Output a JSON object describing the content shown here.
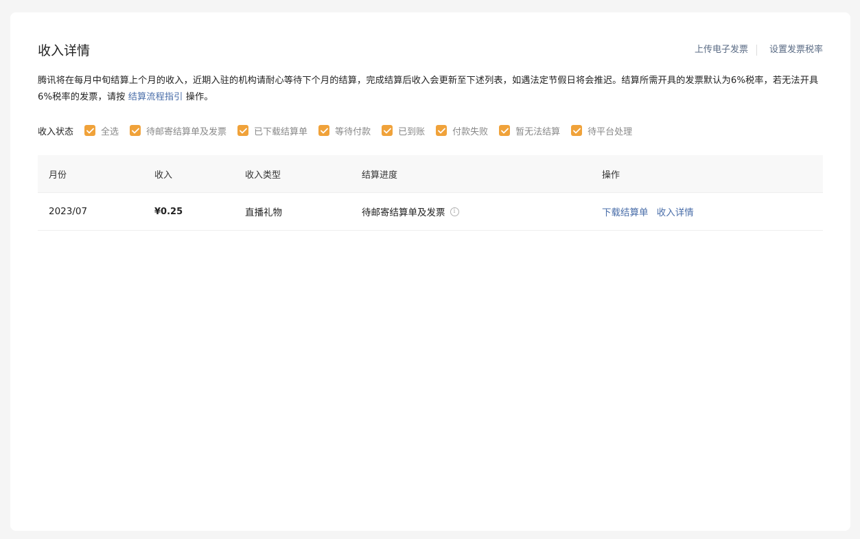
{
  "page": {
    "title": "收入详情",
    "header_actions": {
      "upload_invoice": "上传电子发票",
      "set_tax_rate": "设置发票税率"
    },
    "notice": {
      "text_before_link": "腾讯将在每月中旬结算上个月的收入，近期入驻的机构请耐心等待下个月的结算，完成结算后收入会更新至下述列表，如遇法定节假日将会推迟。结算所需开具的发票默认为6%税率，若无法开具6%税率的发票，请按 ",
      "link": "结算流程指引",
      "text_after_link": " 操作。"
    }
  },
  "status_filter": {
    "label": "收入状态",
    "options": [
      {
        "label": "全选",
        "checked": true
      },
      {
        "label": "待邮寄结算单及发票",
        "checked": true
      },
      {
        "label": "已下载结算单",
        "checked": true
      },
      {
        "label": "等待付款",
        "checked": true
      },
      {
        "label": "已到账",
        "checked": true
      },
      {
        "label": "付款失败",
        "checked": true
      },
      {
        "label": "暂无法结算",
        "checked": true
      },
      {
        "label": "待平台处理",
        "checked": true
      }
    ],
    "check_color": "#f0a23a"
  },
  "table": {
    "headers": [
      "月份",
      "收入",
      "收入类型",
      "结算进度",
      "操作"
    ],
    "rows": [
      {
        "month": "2023/07",
        "amount": "¥0.25",
        "type": "直播礼物",
        "progress": "待邮寄结算单及发票",
        "actions": [
          "下载结算单",
          "收入详情"
        ]
      }
    ]
  },
  "colors": {
    "link": "#4a6ea9",
    "accent": "#f0a23a"
  }
}
